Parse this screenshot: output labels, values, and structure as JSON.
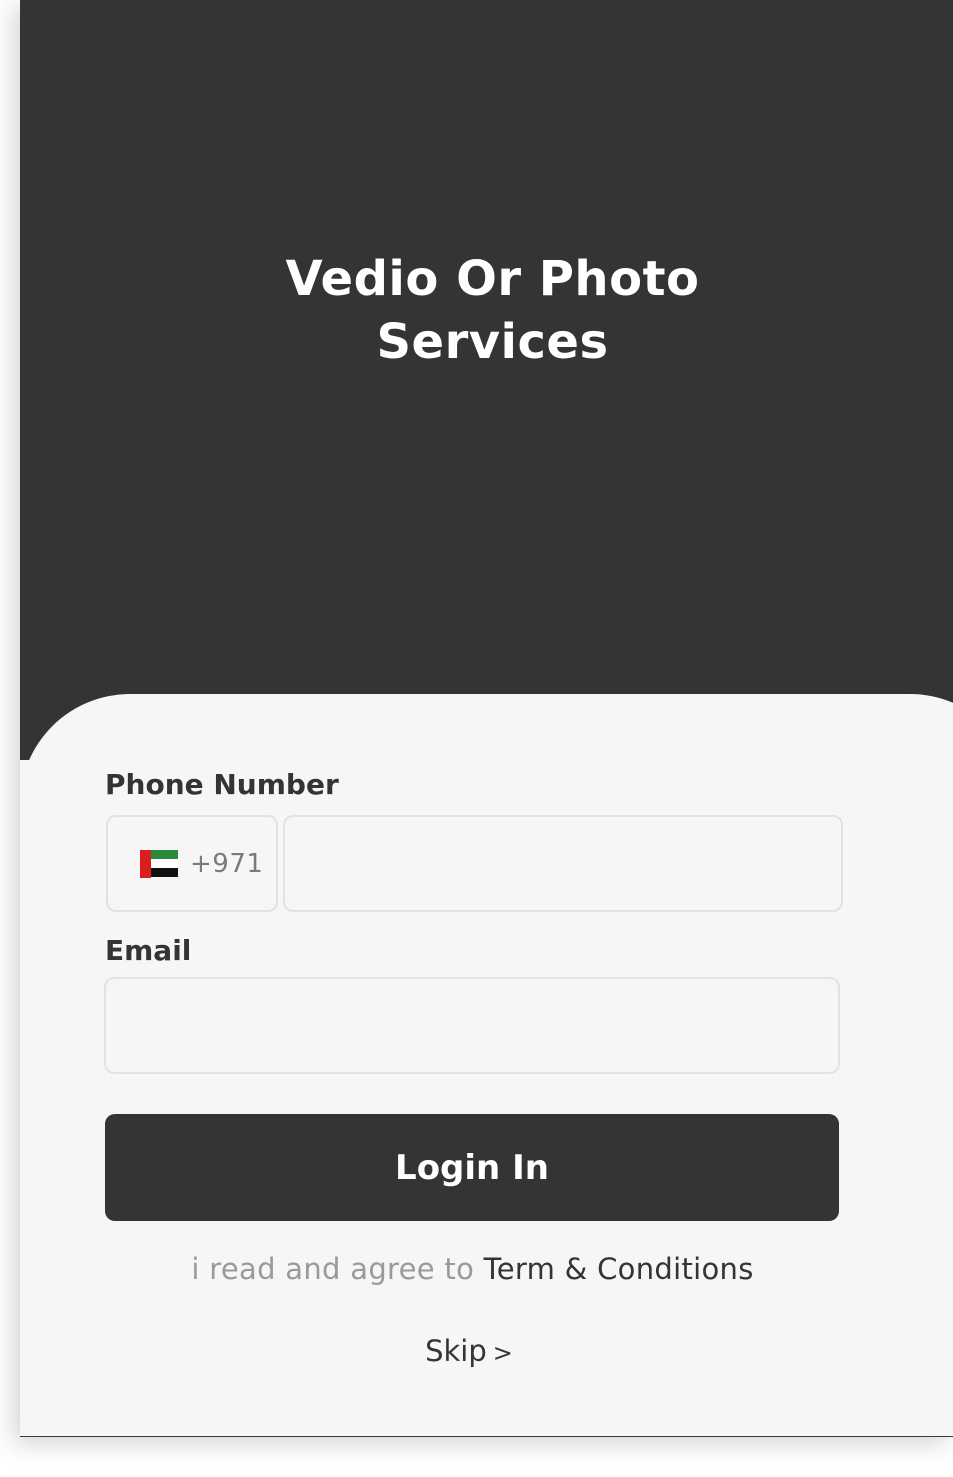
{
  "hero": {
    "title_line1": "Vedio Or Photo",
    "title_line2": "Services"
  },
  "phone": {
    "label": "Phone Number",
    "country_code": "+971",
    "flag_icon": "uae-flag-icon",
    "value": "",
    "placeholder": ""
  },
  "email": {
    "label": "Email",
    "value": "",
    "placeholder": ""
  },
  "login": {
    "label": "Login In"
  },
  "terms": {
    "prefix": "i read and agree to",
    "link": "Term & Conditions"
  },
  "skip": {
    "label": "Skip",
    "chevron": ">"
  },
  "colors": {
    "dark": "#343434",
    "panel": "#f6f6f6",
    "muted": "#9a9a9a",
    "border": "#e2e2e2"
  }
}
